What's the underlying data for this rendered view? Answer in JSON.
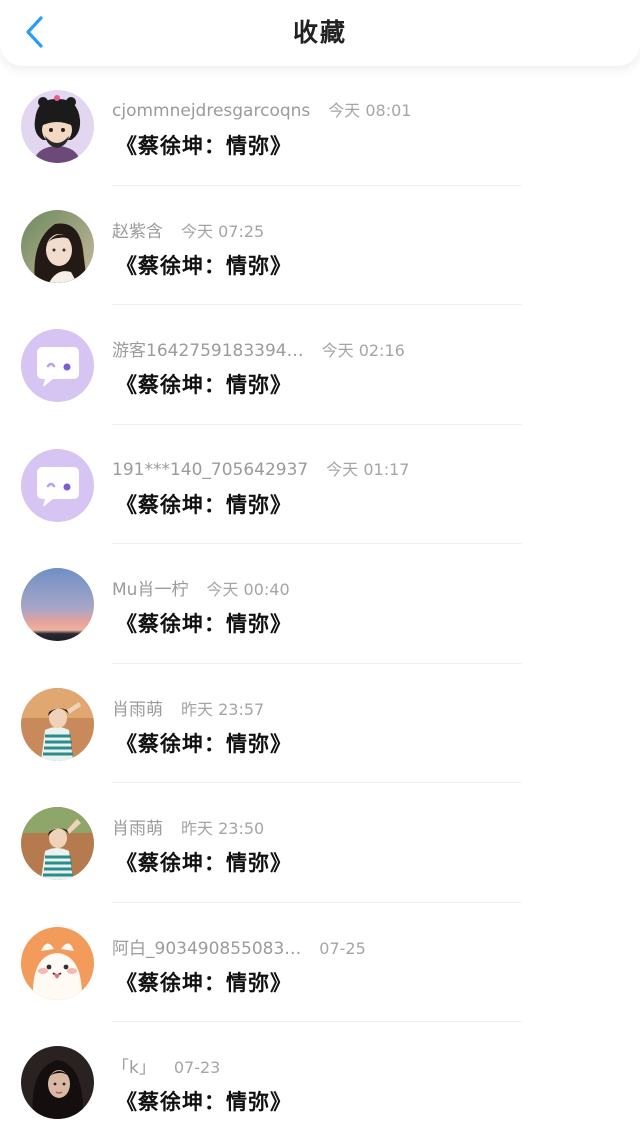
{
  "header": {
    "title": "收藏",
    "back_icon": "chevron-left-icon",
    "accent_color": "#2a9df4"
  },
  "items": [
    {
      "name": "cjommnejdresgarcoqns",
      "time": "今天 08:01",
      "content": "《蔡徐坤：情弥》",
      "avatar": "cartoon-character"
    },
    {
      "name": "赵紫含",
      "time": "今天 07:25",
      "content": "《蔡徐坤：情弥》",
      "avatar": "photo-girl"
    },
    {
      "name": "游客1642759183394…",
      "time": "今天 02:16",
      "content": "《蔡徐坤：情弥》",
      "avatar": "default-chat-bubble"
    },
    {
      "name": "191***140_705642937",
      "time": "今天 01:17",
      "content": "《蔡徐坤：情弥》",
      "avatar": "default-chat-bubble"
    },
    {
      "name": "Mu肖一柠",
      "time": "今天 00:40",
      "content": "《蔡徐坤：情弥》",
      "avatar": "sunset-sky"
    },
    {
      "name": "肖雨萌",
      "time": "昨天 23:57",
      "content": "《蔡徐坤：情弥》",
      "avatar": "photo-person"
    },
    {
      "name": "肖雨萌",
      "time": "昨天 23:50",
      "content": "《蔡徐坤：情弥》",
      "avatar": "photo-person"
    },
    {
      "name": "阿白_903490855083…",
      "time": "07-25",
      "content": "《蔡徐坤：情弥》",
      "avatar": "cartoon-dog"
    },
    {
      "name": "「k」",
      "time": "07-23",
      "content": "《蔡徐坤：情弥》",
      "avatar": "photo-dark-hair"
    }
  ]
}
